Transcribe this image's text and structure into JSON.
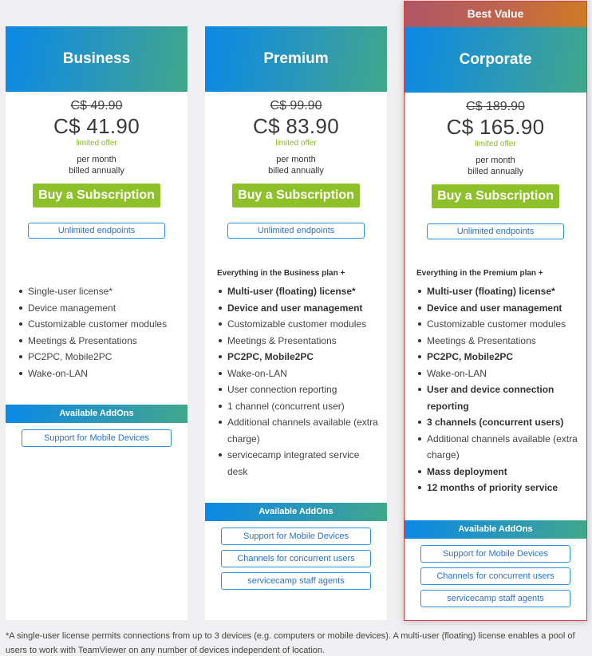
{
  "plans": [
    {
      "name": "Business",
      "ribbon": null,
      "old_price": "C$ 49.90",
      "new_price": "C$ 41.90",
      "offer_label": "limited offer",
      "billing_line1": "per month",
      "billing_line2": "billed annually",
      "buy_label": "Buy a Subscription",
      "endpoints_label": "Unlimited endpoints",
      "intro": "",
      "features": [
        {
          "text": "Single-user license*",
          "bold": false
        },
        {
          "text": "Device management",
          "bold": false
        },
        {
          "text": "Customizable customer modules",
          "bold": false
        },
        {
          "text": "Meetings & Presentations",
          "bold": false
        },
        {
          "text": "PC2PC, Mobile2PC",
          "bold": false
        },
        {
          "text": "Wake-on-LAN",
          "bold": false
        }
      ],
      "addons_title": "Available AddOns",
      "addons": [
        "Support for Mobile Devices"
      ]
    },
    {
      "name": "Premium",
      "ribbon": null,
      "old_price": "C$ 99.90",
      "new_price": "C$ 83.90",
      "offer_label": "limited offer",
      "billing_line1": "per month",
      "billing_line2": "billed annually",
      "buy_label": "Buy a Subscription",
      "endpoints_label": "Unlimited endpoints",
      "intro": "Everything in the Business plan +",
      "features": [
        {
          "text": "Multi-user (floating) license*",
          "bold": true
        },
        {
          "text": "Device and user management",
          "bold": true
        },
        {
          "text": "Customizable customer modules",
          "bold": false
        },
        {
          "text": "Meetings & Presentations",
          "bold": false
        },
        {
          "text": "PC2PC, Mobile2PC",
          "bold": true
        },
        {
          "text": "Wake-on-LAN",
          "bold": false
        },
        {
          "text": "User connection reporting",
          "bold": false
        },
        {
          "text": "1 channel (concurrent user)",
          "bold": false
        },
        {
          "text": "Additional channels available (extra charge)",
          "bold": false
        },
        {
          "text": "servicecamp integrated service desk",
          "bold": false
        }
      ],
      "addons_title": "Available AddOns",
      "addons": [
        "Support for Mobile Devices",
        "Channels for concurrent users",
        "servicecamp staff agents"
      ]
    },
    {
      "name": "Corporate",
      "ribbon": "Best Value",
      "old_price": "C$ 189.90",
      "new_price": "C$ 165.90",
      "offer_label": "limited offer",
      "billing_line1": "per month",
      "billing_line2": "billed annually",
      "buy_label": "Buy a Subscription",
      "endpoints_label": "Unlimited endpoints",
      "intro": "Everything in the Premium plan +",
      "features": [
        {
          "text": "Multi-user (floating) license*",
          "bold": true
        },
        {
          "text": "Device and user management",
          "bold": true
        },
        {
          "text": "Customizable customer modules",
          "bold": false
        },
        {
          "text": "Meetings & Presentations",
          "bold": false
        },
        {
          "text": "PC2PC, Mobile2PC",
          "bold": true
        },
        {
          "text": "Wake-on-LAN",
          "bold": false
        },
        {
          "text": "User and device connection reporting",
          "bold": true
        },
        {
          "text": "3 channels (concurrent users)",
          "bold": true
        },
        {
          "text": "Additional channels available (extra charge)",
          "bold": false
        },
        {
          "text": "Mass deployment",
          "bold": true
        },
        {
          "text": "12 months of priority service",
          "bold": true
        }
      ],
      "addons_title": "Available AddOns",
      "addons": [
        "Support for Mobile Devices",
        "Channels for concurrent users",
        "servicecamp staff agents"
      ]
    }
  ],
  "footnote": "*A single-user license permits connections from up to 3 devices (e.g. computers or mobile devices). A multi-user (floating) license enables a pool of users to work with TeamViewer on any number of devices independent of location.",
  "colors": {
    "page_bg": "#efeff1",
    "header_gradient_start": "#0a88e6",
    "header_gradient_end": "#41a78a",
    "ribbon_gradient_start": "#b05566",
    "ribbon_gradient_end": "#ce7b24",
    "buy_button": "#8ec02a",
    "offer_text": "#8bb82a",
    "highlight_border": "#e2403f",
    "outline_button": "#2f8fdc"
  }
}
